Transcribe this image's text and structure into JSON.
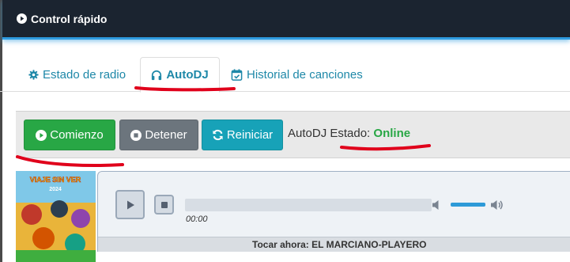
{
  "header": {
    "title": "Control rápido"
  },
  "tabs": [
    {
      "label": "Estado de radio",
      "icon": "gear-icon",
      "active": false
    },
    {
      "label": "AutoDJ",
      "icon": "headphones-icon",
      "active": true
    },
    {
      "label": "Historial de canciones",
      "icon": "calendar-check-icon",
      "active": false
    }
  ],
  "controls": {
    "start_label": "Comienzo",
    "stop_label": "Detener",
    "restart_label": "Reiniciar",
    "status_label": "AutoDJ Estado:",
    "status_value": "Online"
  },
  "album": {
    "text_top": "VIAJE SIN VER",
    "text_year": "2024"
  },
  "player": {
    "time": "00:00",
    "progress": 0,
    "volume": 1.0,
    "now_playing": "Tocar ahora: EL MARCIANO-PLAYERO"
  },
  "colors": {
    "header_bg": "#1b2430",
    "accent": "#2f9be0",
    "tab_link": "#1e88a8",
    "start": "#28a745",
    "stop": "#6c757d",
    "restart": "#17a2b8",
    "status_online": "#28a745",
    "annotation": "#e0001b"
  }
}
